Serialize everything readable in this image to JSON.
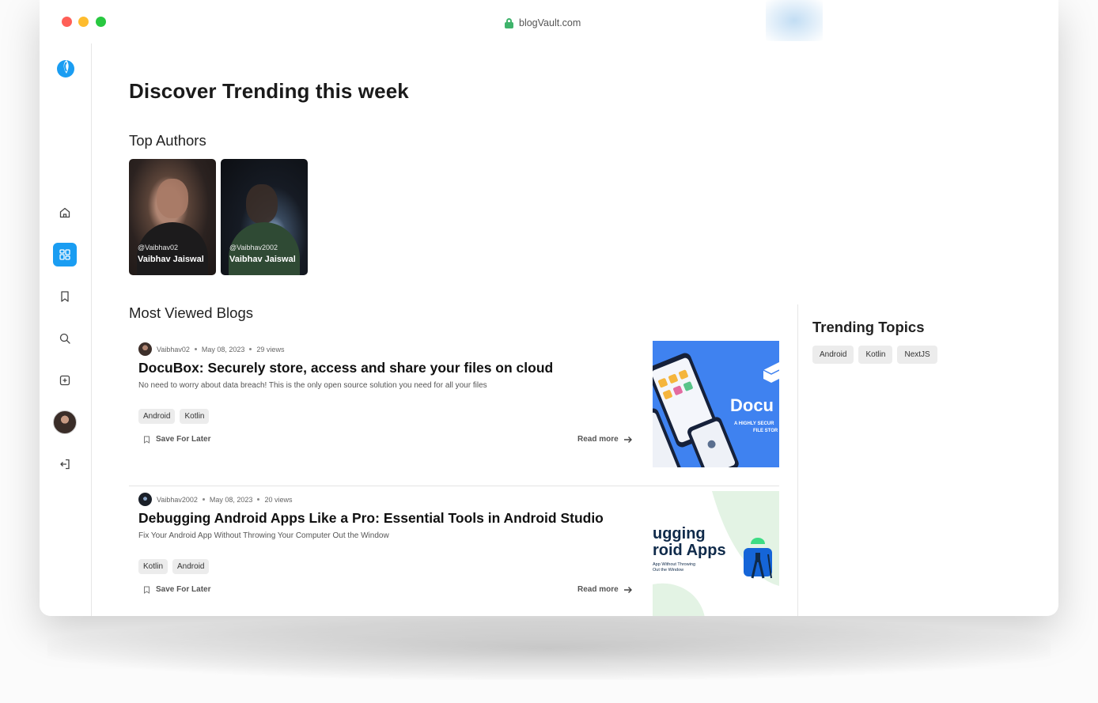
{
  "browser": {
    "url": "blogVault.com"
  },
  "sidebar": {
    "items": [
      {
        "name": "home",
        "icon": "home-icon"
      },
      {
        "name": "explore",
        "icon": "dashboard-icon",
        "active": true
      },
      {
        "name": "bookmarks",
        "icon": "bookmark-icon"
      },
      {
        "name": "search",
        "icon": "search-icon"
      },
      {
        "name": "new-post",
        "icon": "add-square-icon"
      },
      {
        "name": "profile",
        "icon": "avatar"
      },
      {
        "name": "logout",
        "icon": "logout-icon"
      }
    ],
    "accent": "#1a9df2"
  },
  "main": {
    "page_title": "Discover Trending this week",
    "top_authors_title": "Top Authors",
    "authors": [
      {
        "handle": "@Vaibhav02",
        "name": "Vaibhav Jaiswal"
      },
      {
        "handle": "@Vaibhav2002",
        "name": "Vaibhav Jaiswal"
      }
    ],
    "most_viewed_title": "Most Viewed Blogs",
    "blogs": [
      {
        "author": "Vaibhav02",
        "date": "May 08, 2023",
        "views": "29 views",
        "title": "DocuBox: Securely store, access and share your files on cloud",
        "description": "No need to worry about data breach! This is the only open source solution you need for all your files",
        "tags": [
          "Android",
          "Kotlin"
        ],
        "save_label": "Save For Later",
        "read_more_label": "Read more",
        "thumb_text": "Docu",
        "thumb_sub1": "A HIGHLY SECUR",
        "thumb_sub2": "FILE STOR"
      },
      {
        "author": "Vaibhav2002",
        "date": "May 08, 2023",
        "views": "20 views",
        "title": "Debugging Android Apps Like a Pro: Essential Tools in Android Studio",
        "description": "Fix Your Android App Without Throwing Your Computer Out the Window",
        "tags": [
          "Kotlin",
          "Android"
        ],
        "save_label": "Save For Later",
        "read_more_label": "Read more",
        "thumb_line1": "ugging",
        "thumb_line2": "roid Apps",
        "thumb_sub1": "App Without Throwing",
        "thumb_sub2": "Out the Window"
      }
    ]
  },
  "trending": {
    "title": "Trending Topics",
    "topics": [
      "Android",
      "Kotlin",
      "NextJS"
    ]
  }
}
